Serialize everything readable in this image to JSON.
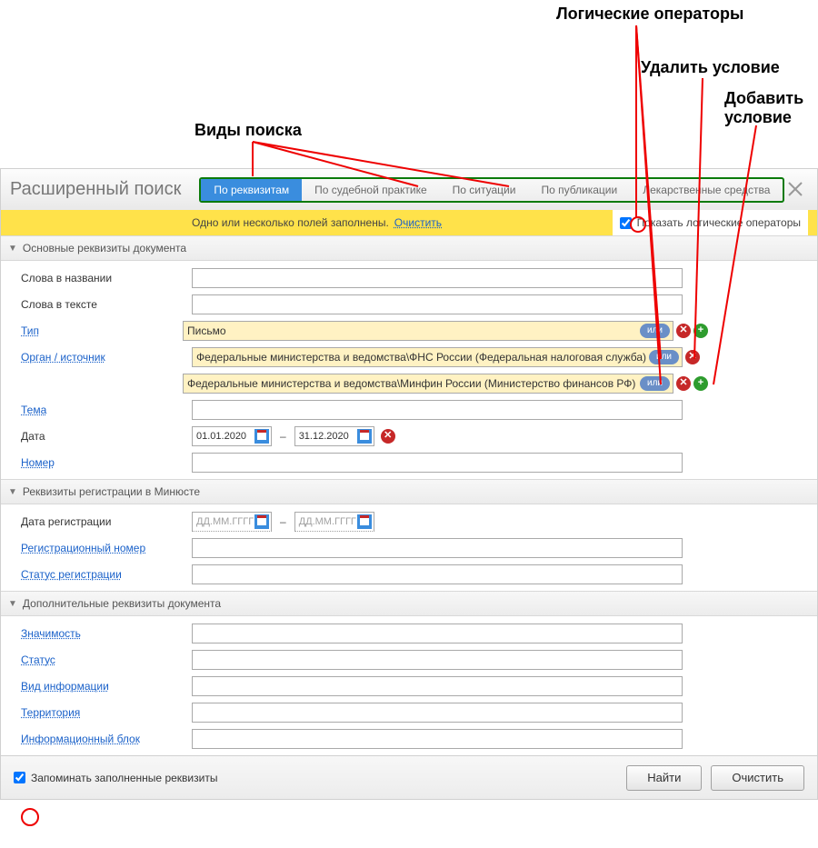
{
  "annotations": {
    "logical_ops": "Логические операторы",
    "delete_cond": "Удалить условие",
    "add_cond": "Добавить условие",
    "search_types": "Виды поиска"
  },
  "header": {
    "title": "Расширенный поиск",
    "tabs": [
      "По реквизитам",
      "По судебной практике",
      "По ситуации",
      "По публикации",
      "Лекарственные средства"
    ]
  },
  "notice": {
    "text": "Одно или несколько полей заполнены.",
    "clear": "Очистить",
    "show_ops": "Показать логические операторы"
  },
  "sections": {
    "main": "Основные реквизиты документа",
    "reg": "Реквизиты регистрации в Минюсте",
    "extra": "Дополнительные реквизиты документа"
  },
  "labels": {
    "words_title": "Слова в названии",
    "words_text": "Слова в тексте",
    "type": "Тип",
    "organ": "Орган / источник",
    "theme": "Тема",
    "date": "Дата",
    "number": "Номер",
    "reg_date": "Дата регистрации",
    "reg_number": "Регистрационный номер",
    "reg_status": "Статус регистрации",
    "importance": "Значимость",
    "status": "Статус",
    "info_type": "Вид информации",
    "territory": "Территория",
    "info_block": "Информационный блок"
  },
  "values": {
    "type": "Письмо",
    "organ1": "Федеральные министерства и ведомства\\ФНС России (Федеральная налоговая служба)",
    "organ2": "Федеральные министерства и ведомства\\Минфин России (Министерство финансов РФ)",
    "date_from": "01.01.2020",
    "date_to": "31.12.2020",
    "date_placeholder": "ДД.ММ.ГГГГ",
    "or_badge": "или"
  },
  "footer": {
    "remember": "Запоминать заполненные реквизиты",
    "find": "Найти",
    "clear": "Очистить"
  }
}
